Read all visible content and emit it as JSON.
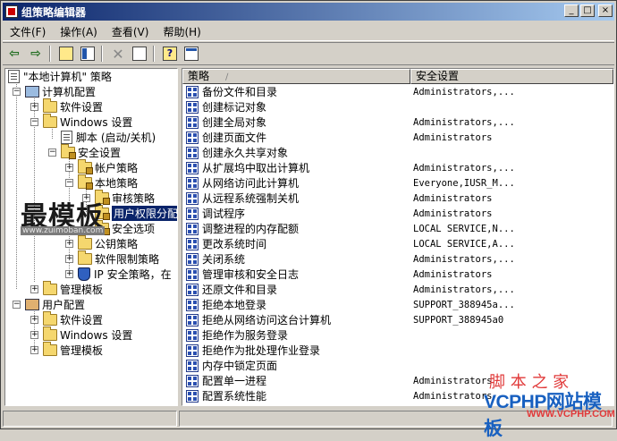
{
  "window": {
    "title": "组策略编辑器"
  },
  "title_controls": {
    "minimize": "_",
    "maximize": "□",
    "close": "×"
  },
  "menu": [
    "文件(F)",
    "操作(A)",
    "查看(V)",
    "帮助(H)"
  ],
  "toolbar": [
    "back-arrow-icon",
    "forward-arrow-icon",
    "up-folder-icon",
    "show-hide-tree-icon",
    "delete-icon",
    "export-list-icon",
    "help-icon",
    "properties-icon"
  ],
  "tree": {
    "root": "\"本地计算机\" 策略",
    "computer": "计算机配置",
    "software": "软件设置",
    "windows": "Windows 设置",
    "scripts": "脚本 (启动/关机)",
    "security": "安全设置",
    "account_policy": "帐户策略",
    "local_policy": "本地策略",
    "audit": "审核策略",
    "user_rights": "用户权限分配",
    "security_options": "安全选项",
    "public_key": "公钥策略",
    "software_restriction": "软件限制策略",
    "ipsec": "IP 安全策略，在",
    "admin_templates": "管理模板",
    "user_config": "用户配置",
    "user_software": "软件设置",
    "user_windows": "Windows 设置",
    "user_admin_templates": "管理模板"
  },
  "list": {
    "columns": [
      "策略",
      "安全设置"
    ],
    "rows": [
      {
        "name": "备份文件和目录",
        "setting": "Administrators,..."
      },
      {
        "name": "创建标记对象",
        "setting": ""
      },
      {
        "name": "创建全局对象",
        "setting": "Administrators,..."
      },
      {
        "name": "创建页面文件",
        "setting": "Administrators"
      },
      {
        "name": "创建永久共享对象",
        "setting": ""
      },
      {
        "name": "从扩展坞中取出计算机",
        "setting": "Administrators,..."
      },
      {
        "name": "从网络访问此计算机",
        "setting": "Everyone,IUSR_M..."
      },
      {
        "name": "从远程系统强制关机",
        "setting": "Administrators"
      },
      {
        "name": "调试程序",
        "setting": "Administrators"
      },
      {
        "name": "调整进程的内存配额",
        "setting": "LOCAL SERVICE,N..."
      },
      {
        "name": "更改系统时间",
        "setting": "LOCAL SERVICE,A..."
      },
      {
        "name": "关闭系统",
        "setting": "Administrators,..."
      },
      {
        "name": "管理审核和安全日志",
        "setting": "Administrators"
      },
      {
        "name": "还原文件和目录",
        "setting": "Administrators,..."
      },
      {
        "name": "拒绝本地登录",
        "setting": "SUPPORT_388945a..."
      },
      {
        "name": "拒绝从网络访问这台计算机",
        "setting": "SUPPORT_388945a0"
      },
      {
        "name": "拒绝作为服务登录",
        "setting": ""
      },
      {
        "name": "拒绝作为批处理作业登录",
        "setting": ""
      },
      {
        "name": "内存中锁定页面",
        "setting": ""
      },
      {
        "name": "配置单一进程",
        "setting": "Administrators"
      },
      {
        "name": "配置系统性能",
        "setting": "Administrators"
      }
    ]
  },
  "watermark": {
    "left_big": "最模板",
    "left_small": "www.zuimoban.com",
    "right_red": "脚 本 之 家",
    "right_blue": "VCPHP网站模板",
    "right_url": "WWW.VCPHP.COM"
  }
}
